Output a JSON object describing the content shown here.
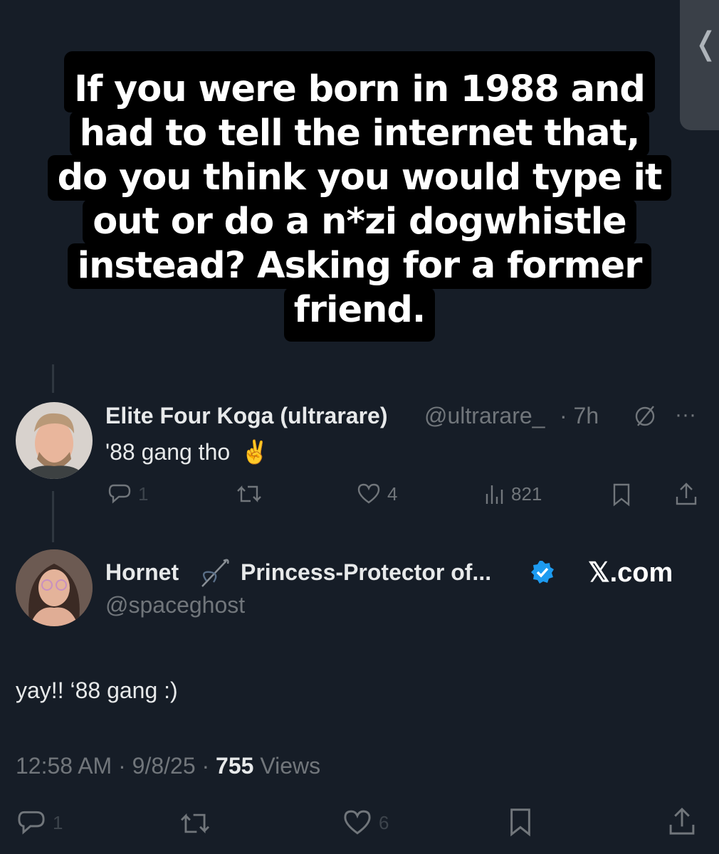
{
  "caption": {
    "lines": [
      "If you were born in 1988 and",
      "had to tell the internet that,",
      "do you think you would type it",
      "out or do a n*zi dogwhistle",
      "instead? Asking for a former",
      "friend."
    ]
  },
  "reply1": {
    "name": "Elite Four Koga (ultrarare)",
    "handle": "@ultrarare_",
    "time": "· 7h",
    "text": "'88 gang tho",
    "emoji": "✌️",
    "reply_count": "1",
    "like_count": "4",
    "view_count": "821"
  },
  "reply2": {
    "name": "Hornet",
    "name_suffix": "Princess-Protector of...",
    "handle": "@spaceghost",
    "brand": "𝕏.com",
    "text": "yay!! ‘88 gang :)",
    "time": "12:58 AM",
    "date": "9/8/25",
    "views_count": "755",
    "views_label": "Views",
    "reply_count": "1",
    "like_count": "6"
  },
  "icons": {
    "side": "chevron-left-icon",
    "mute": "slash-circle-icon",
    "more": "more-dots-icon",
    "reply": "reply-icon",
    "retweet": "retweet-icon",
    "like": "heart-icon",
    "views": "views-bar-icon",
    "bookmark": "bookmark-icon",
    "share": "share-icon",
    "verified": "verified-badge-icon",
    "needle": "needle-icon"
  },
  "colors": {
    "background": "#161d27",
    "caption_bg": "#000000",
    "text": "#e7e9ea",
    "muted": "#71767b",
    "verified": "#1d9bf0"
  }
}
